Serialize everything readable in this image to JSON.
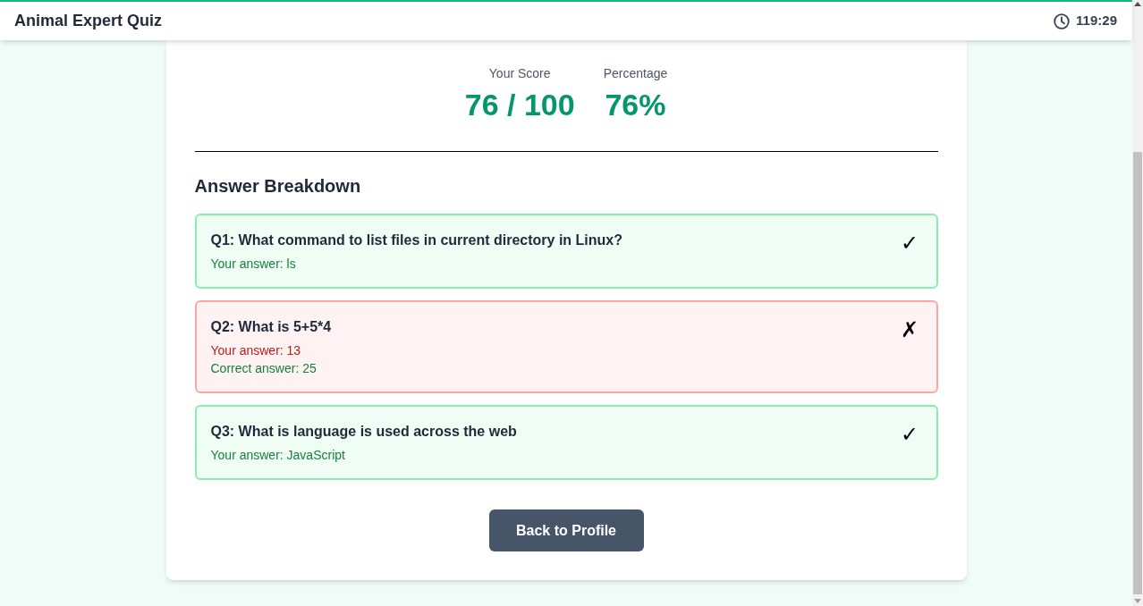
{
  "header": {
    "title": "Animal Expert Quiz",
    "timer": "119:29"
  },
  "score": [
    {
      "label": "Your Score",
      "value": "76 / 100"
    },
    {
      "label": "Percentage",
      "value": "76%"
    }
  ],
  "breakdown": {
    "title": "Answer Breakdown",
    "questions": [
      {
        "question": "Q1: What command to list files in current directory in Linux?",
        "correct": true,
        "mark": "✓",
        "answers": [
          {
            "kind": "given",
            "text": "Your answer: ls"
          }
        ]
      },
      {
        "question": "Q2: What is 5+5*4",
        "correct": false,
        "mark": "✗",
        "answers": [
          {
            "kind": "given",
            "text": "Your answer: 13"
          },
          {
            "kind": "expected",
            "text": "Correct answer: 25"
          }
        ]
      },
      {
        "question": "Q3: What is language is used across the web",
        "correct": true,
        "mark": "✓",
        "answers": [
          {
            "kind": "given",
            "text": "Your answer: JavaScript"
          }
        ]
      }
    ]
  },
  "button": {
    "label": "Back to Profile"
  }
}
